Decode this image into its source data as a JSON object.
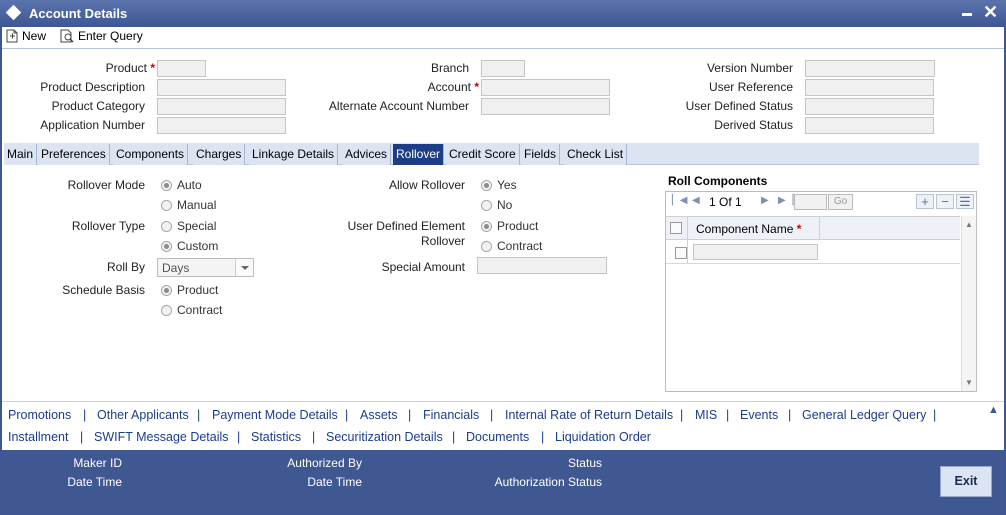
{
  "window": {
    "title": "Account Details"
  },
  "toolbar": {
    "new_label": "New",
    "enter_query_label": "Enter Query"
  },
  "header": {
    "product": "Product",
    "product_description": "Product Description",
    "product_category": "Product Category",
    "application_number": "Application Number",
    "branch": "Branch",
    "account": "Account",
    "alternate_account_number": "Alternate Account Number",
    "version_number": "Version Number",
    "user_reference": "User Reference",
    "user_defined_status": "User Defined Status",
    "derived_status": "Derived Status",
    "required_mark": "*"
  },
  "tabs": [
    "Main",
    "Preferences",
    "Components",
    "Charges",
    "Linkage Details",
    "Advices",
    "Rollover",
    "Credit Score",
    "Fields",
    "Check List"
  ],
  "rollover": {
    "rollover_mode_label": "Rollover Mode",
    "mode_auto": "Auto",
    "mode_manual": "Manual",
    "rollover_type_label": "Rollover Type",
    "type_special": "Special",
    "type_custom": "Custom",
    "roll_by_label": "Roll By",
    "roll_by_value": "Days",
    "schedule_basis_label": "Schedule Basis",
    "basis_product": "Product",
    "basis_contract": "Contract",
    "allow_rollover_label": "Allow Rollover",
    "allow_yes": "Yes",
    "allow_no": "No",
    "ude_rollover_label_1": "User Defined Element",
    "ude_rollover_label_2": "Rollover",
    "ude_product": "Product",
    "ude_contract": "Contract",
    "special_amount_label": "Special Amount"
  },
  "roll_components": {
    "title": "Roll Components",
    "pager_current": "1",
    "pager_of": "Of",
    "pager_total": "1",
    "go_label": "Go",
    "column_header": "Component Name"
  },
  "links_row1": [
    "Promotions",
    "Other Applicants",
    "Payment Mode Details",
    "Assets",
    "Financials",
    "Internal Rate of Return Details",
    "MIS",
    "Events",
    "General Ledger Query"
  ],
  "links_row2": [
    "Installment",
    "SWIFT Message Details",
    "Statistics",
    "Securitization Details",
    "Documents",
    "Liquidation Order"
  ],
  "link_separator": "|",
  "footer": {
    "maker_id": "Maker ID",
    "date_time_1": "Date Time",
    "authorized_by": "Authorized By",
    "date_time_2": "Date Time",
    "status": "Status",
    "authorization_status": "Authorization Status",
    "exit_label": "Exit"
  }
}
